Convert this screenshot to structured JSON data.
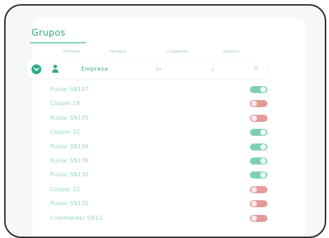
{
  "section": {
    "title": "Grupos"
  },
  "columns": [
    "Permisos",
    "Nombre",
    "Cargadores",
    "Usuarios"
  ],
  "group": {
    "name": "Empresa",
    "chargers": "20",
    "users": "1"
  },
  "chargers": [
    {
      "label": "Pulsar SN137",
      "enabled": true
    },
    {
      "label": "Copper 18",
      "enabled": false
    },
    {
      "label": "Pulsar SN135",
      "enabled": false
    },
    {
      "label": "Copper 12",
      "enabled": true
    },
    {
      "label": "Pulsar SN139",
      "enabled": true
    },
    {
      "label": "Pulsar SN136",
      "enabled": true
    },
    {
      "label": "Pulsar SN130",
      "enabled": true
    },
    {
      "label": "Copper 12",
      "enabled": false
    },
    {
      "label": "Pulsar SN135",
      "enabled": false
    },
    {
      "label": "Commander SN13",
      "enabled": false
    }
  ],
  "colors": {
    "accent": "#2fab86",
    "toggle_on": "#7fcfb6",
    "toggle_off": "#e49a97"
  }
}
